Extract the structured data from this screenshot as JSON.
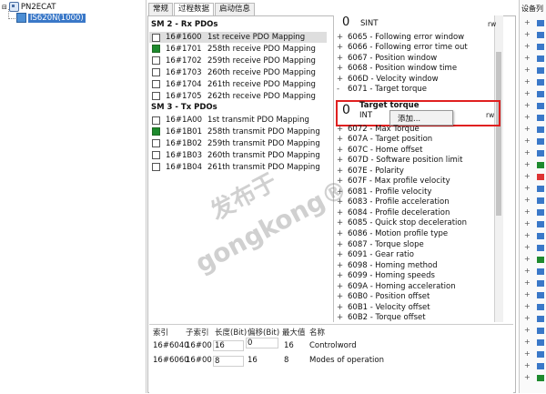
{
  "tree": {
    "root_label": "PN2ECAT",
    "child_label": "IS620N(1000)"
  },
  "tabs": [
    {
      "label": "常规"
    },
    {
      "label": "过程数据"
    },
    {
      "label": "启动信息"
    }
  ],
  "rx_section": {
    "title": "SM 2 - Rx PDOs",
    "items": [
      {
        "index": "16#1600",
        "name": "1st receive PDO Mapping",
        "checked": false,
        "highlighted": true
      },
      {
        "index": "16#1701",
        "name": "258th receive PDO Mapping",
        "checked": true,
        "highlighted": false
      },
      {
        "index": "16#1702",
        "name": "259th receive PDO Mapping",
        "checked": false,
        "highlighted": false
      },
      {
        "index": "16#1703",
        "name": "260th receive PDO Mapping",
        "checked": false,
        "highlighted": false
      },
      {
        "index": "16#1704",
        "name": "261th receive PDO Mapping",
        "checked": false,
        "highlighted": false
      },
      {
        "index": "16#1705",
        "name": "262th receive PDO Mapping",
        "checked": false,
        "highlighted": false
      }
    ]
  },
  "tx_section": {
    "title": "SM 3 - Tx PDOs",
    "items": [
      {
        "index": "16#1A00",
        "name": "1st transmit PDO Mapping",
        "checked": false
      },
      {
        "index": "16#1B01",
        "name": "258th transmit PDO Mapping",
        "checked": true
      },
      {
        "index": "16#1B02",
        "name": "259th transmit PDO Mapping",
        "checked": false
      },
      {
        "index": "16#1B03",
        "name": "260th transmit PDO Mapping",
        "checked": false
      },
      {
        "index": "16#1B04",
        "name": "261th transmit PDO Mapping",
        "checked": false
      }
    ]
  },
  "object_dict": {
    "top_header": {
      "value": "0",
      "type": "SINT",
      "access": "rw"
    },
    "items_above": [
      {
        "bullet": "+",
        "text": "6065 - Following error window"
      },
      {
        "bullet": "+",
        "text": "6066 - Following error time out"
      },
      {
        "bullet": "+",
        "text": "6067 - Position window"
      },
      {
        "bullet": "+",
        "text": "6068 - Position window time"
      },
      {
        "bullet": "+",
        "text": "606D - Velocity window"
      },
      {
        "bullet": "-",
        "text": "6071 - Target torque"
      }
    ],
    "selected": {
      "value": "0",
      "title": "Target torque",
      "type": "INT",
      "access": "rw"
    },
    "context_menu": {
      "item": "添加..."
    },
    "items_below": [
      {
        "bullet": "+",
        "text": "6072 - Max Torque"
      },
      {
        "bullet": "+",
        "text": "607A - Target position"
      },
      {
        "bullet": "+",
        "text": "607C - Home offset"
      },
      {
        "bullet": "+",
        "text": "607D - Software position limit"
      },
      {
        "bullet": "+",
        "text": "607E - Polarity"
      },
      {
        "bullet": "+",
        "text": "607F - Max profile velocity"
      },
      {
        "bullet": "+",
        "text": "6081 - Profile velocity"
      },
      {
        "bullet": "+",
        "text": "6083 - Profile acceleration"
      },
      {
        "bullet": "+",
        "text": "6084 - Profile deceleration"
      },
      {
        "bullet": "+",
        "text": "6085 - Quick stop deceleration"
      },
      {
        "bullet": "+",
        "text": "6086 - Motion profile type"
      },
      {
        "bullet": "+",
        "text": "6087 - Torque slope"
      },
      {
        "bullet": "+",
        "text": "6091 - Gear ratio"
      },
      {
        "bullet": "+",
        "text": "6098 - Homing method"
      },
      {
        "bullet": "+",
        "text": "6099 - Homing speeds"
      },
      {
        "bullet": "+",
        "text": "609A - Homing acceleration"
      },
      {
        "bullet": "+",
        "text": "60B0 - Position offset"
      },
      {
        "bullet": "+",
        "text": "60B1 - Velocity offset"
      },
      {
        "bullet": "+",
        "text": "60B2 - Torque offset"
      }
    ]
  },
  "grid": {
    "headers": [
      "索引",
      "子索引",
      "长度(Bit)",
      "偏移(Bit)",
      "最大值",
      "名称"
    ],
    "rows": [
      {
        "index": "16#6040",
        "subindex": "16#00",
        "length": "16",
        "offset": "0",
        "max": "16",
        "name": "Controlword"
      },
      {
        "index": "16#6060",
        "subindex": "16#00",
        "length": "8",
        "offset": "16",
        "max": "8",
        "name": "Modes of operation"
      }
    ]
  },
  "toolbox": {
    "title": "设备列"
  },
  "watermark": {
    "text1": "发布于",
    "text2": "gongkong®"
  },
  "colors": {
    "checked_green": "#1e8a2e",
    "selection_blue": "#3a78c8",
    "highlight_red": "#e02020"
  }
}
